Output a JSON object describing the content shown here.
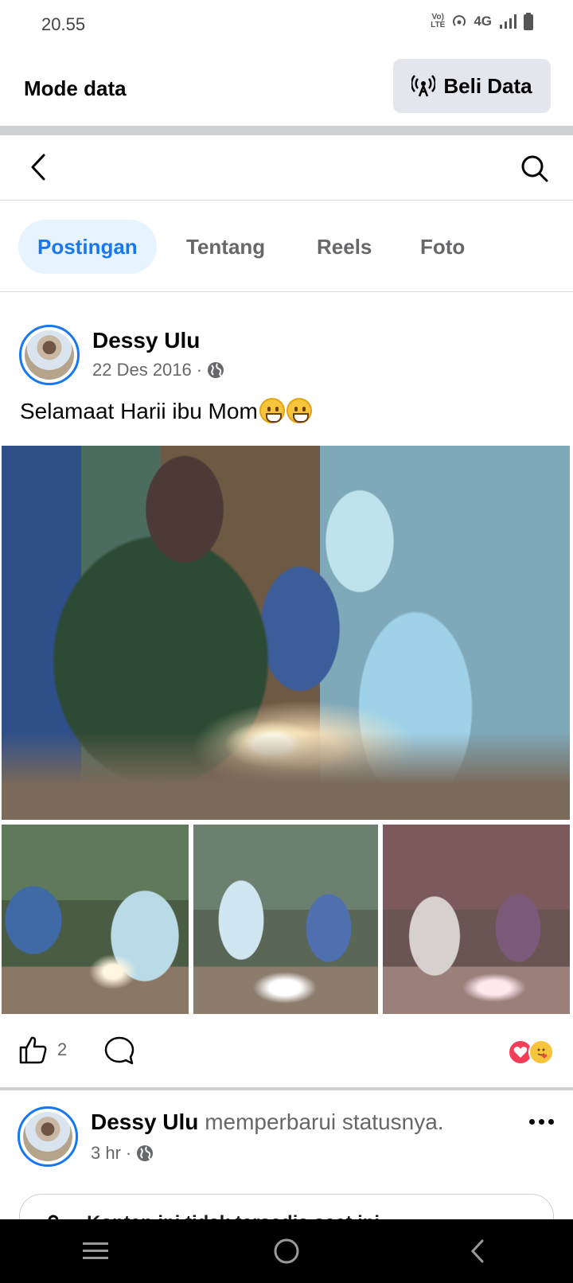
{
  "status_bar": {
    "time": "20.55",
    "volte": "Vo) LTE",
    "network": "4G"
  },
  "data_bar": {
    "label": "Mode data",
    "buy_button": "Beli Data"
  },
  "tabs": [
    {
      "label": "Postingan",
      "active": true
    },
    {
      "label": "Tentang",
      "active": false
    },
    {
      "label": "Reels",
      "active": false
    },
    {
      "label": "Foto",
      "active": false
    }
  ],
  "post": {
    "author": "Dessy Ulu",
    "date": "22 Des 2016",
    "separator": "·",
    "text": "Selamaat Harii ibu Mom",
    "like_count": "2",
    "reactions": [
      "love",
      "care"
    ]
  },
  "post2": {
    "author": "Dessy Ulu",
    "action": "memperbarui statusnya.",
    "time": "3 hr",
    "separator": "·",
    "card_text": "Konten ini tidak tersedia saat ini"
  },
  "colors": {
    "accent": "#1877f2",
    "tab_active_bg": "#e7f3ff",
    "divider": "#ced0d4",
    "text_secondary": "#65676b"
  }
}
